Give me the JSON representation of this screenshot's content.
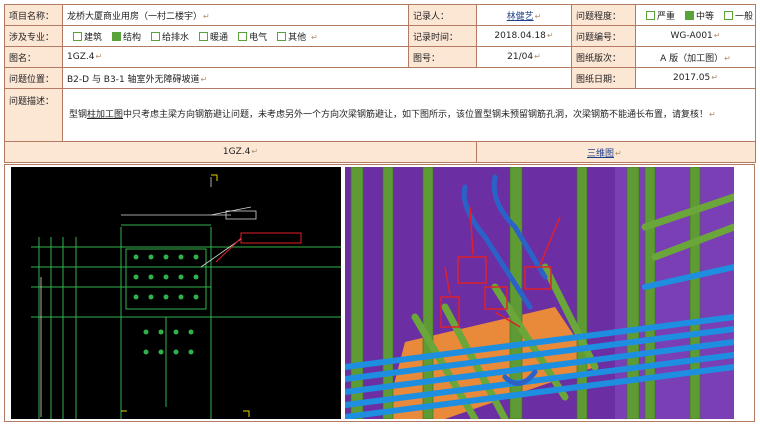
{
  "form": {
    "project_name": {
      "label": "项目名称：",
      "value": "龙桥大厦商业用房（一村二楼宇）"
    },
    "recorder": {
      "label": "记录人：",
      "value": "林健艺"
    },
    "severity": {
      "label": "问题程度：",
      "options": [
        {
          "text": "严重",
          "checked": false
        },
        {
          "text": "中等",
          "checked": true
        },
        {
          "text": "一般",
          "checked": false
        }
      ]
    },
    "discipline": {
      "label": "涉及专业：",
      "options": [
        {
          "text": "建筑",
          "checked": false
        },
        {
          "text": "结构",
          "checked": true
        },
        {
          "text": "给排水",
          "checked": false
        },
        {
          "text": "暖通",
          "checked": false
        },
        {
          "text": "电气",
          "checked": false
        },
        {
          "text": "其他",
          "checked": false
        }
      ]
    },
    "record_time": {
      "label": "记录时间：",
      "value": "2018.04.18"
    },
    "issue_number": {
      "label": "问题编号：",
      "value": "WG-A001"
    },
    "drawing_name": {
      "label": "图名：",
      "value": "1GZ.4"
    },
    "drawing_number": {
      "label": "图号：",
      "value": "21/04"
    },
    "drawing_version": {
      "label": "图纸版次：",
      "value": "A 版（加工图）"
    },
    "location": {
      "label": "问题位置：",
      "value": "B2-D 与 B3-1 轴室外无障碍坡道"
    },
    "drawing_date": {
      "label": "图纸日期：",
      "value": "2017.05"
    },
    "description": {
      "label": "问题描述：",
      "pre": "型钢",
      "highlight": "柱加工图",
      "post": "中只考虑主梁方向钢筋避让问题，未考虑另外一个方向次梁钢筋避让，如下图所示，该位置型钢未预留钢筋孔洞，次梁钢筋不能通长布置，请复核！"
    },
    "return_mark": "↵"
  },
  "captions": {
    "left": "1GZ.4",
    "right": "三维图"
  },
  "colors": {
    "border": "#b57b62",
    "label_bg": "#fce6d4",
    "check_green": "#5aa33a",
    "cad_bg": "#000000",
    "model_bg": "#6b2fa3",
    "rebar_green": "#6aa63a",
    "rebar_blue": "#1e8fe0",
    "annotation_red": "#e0202a"
  }
}
